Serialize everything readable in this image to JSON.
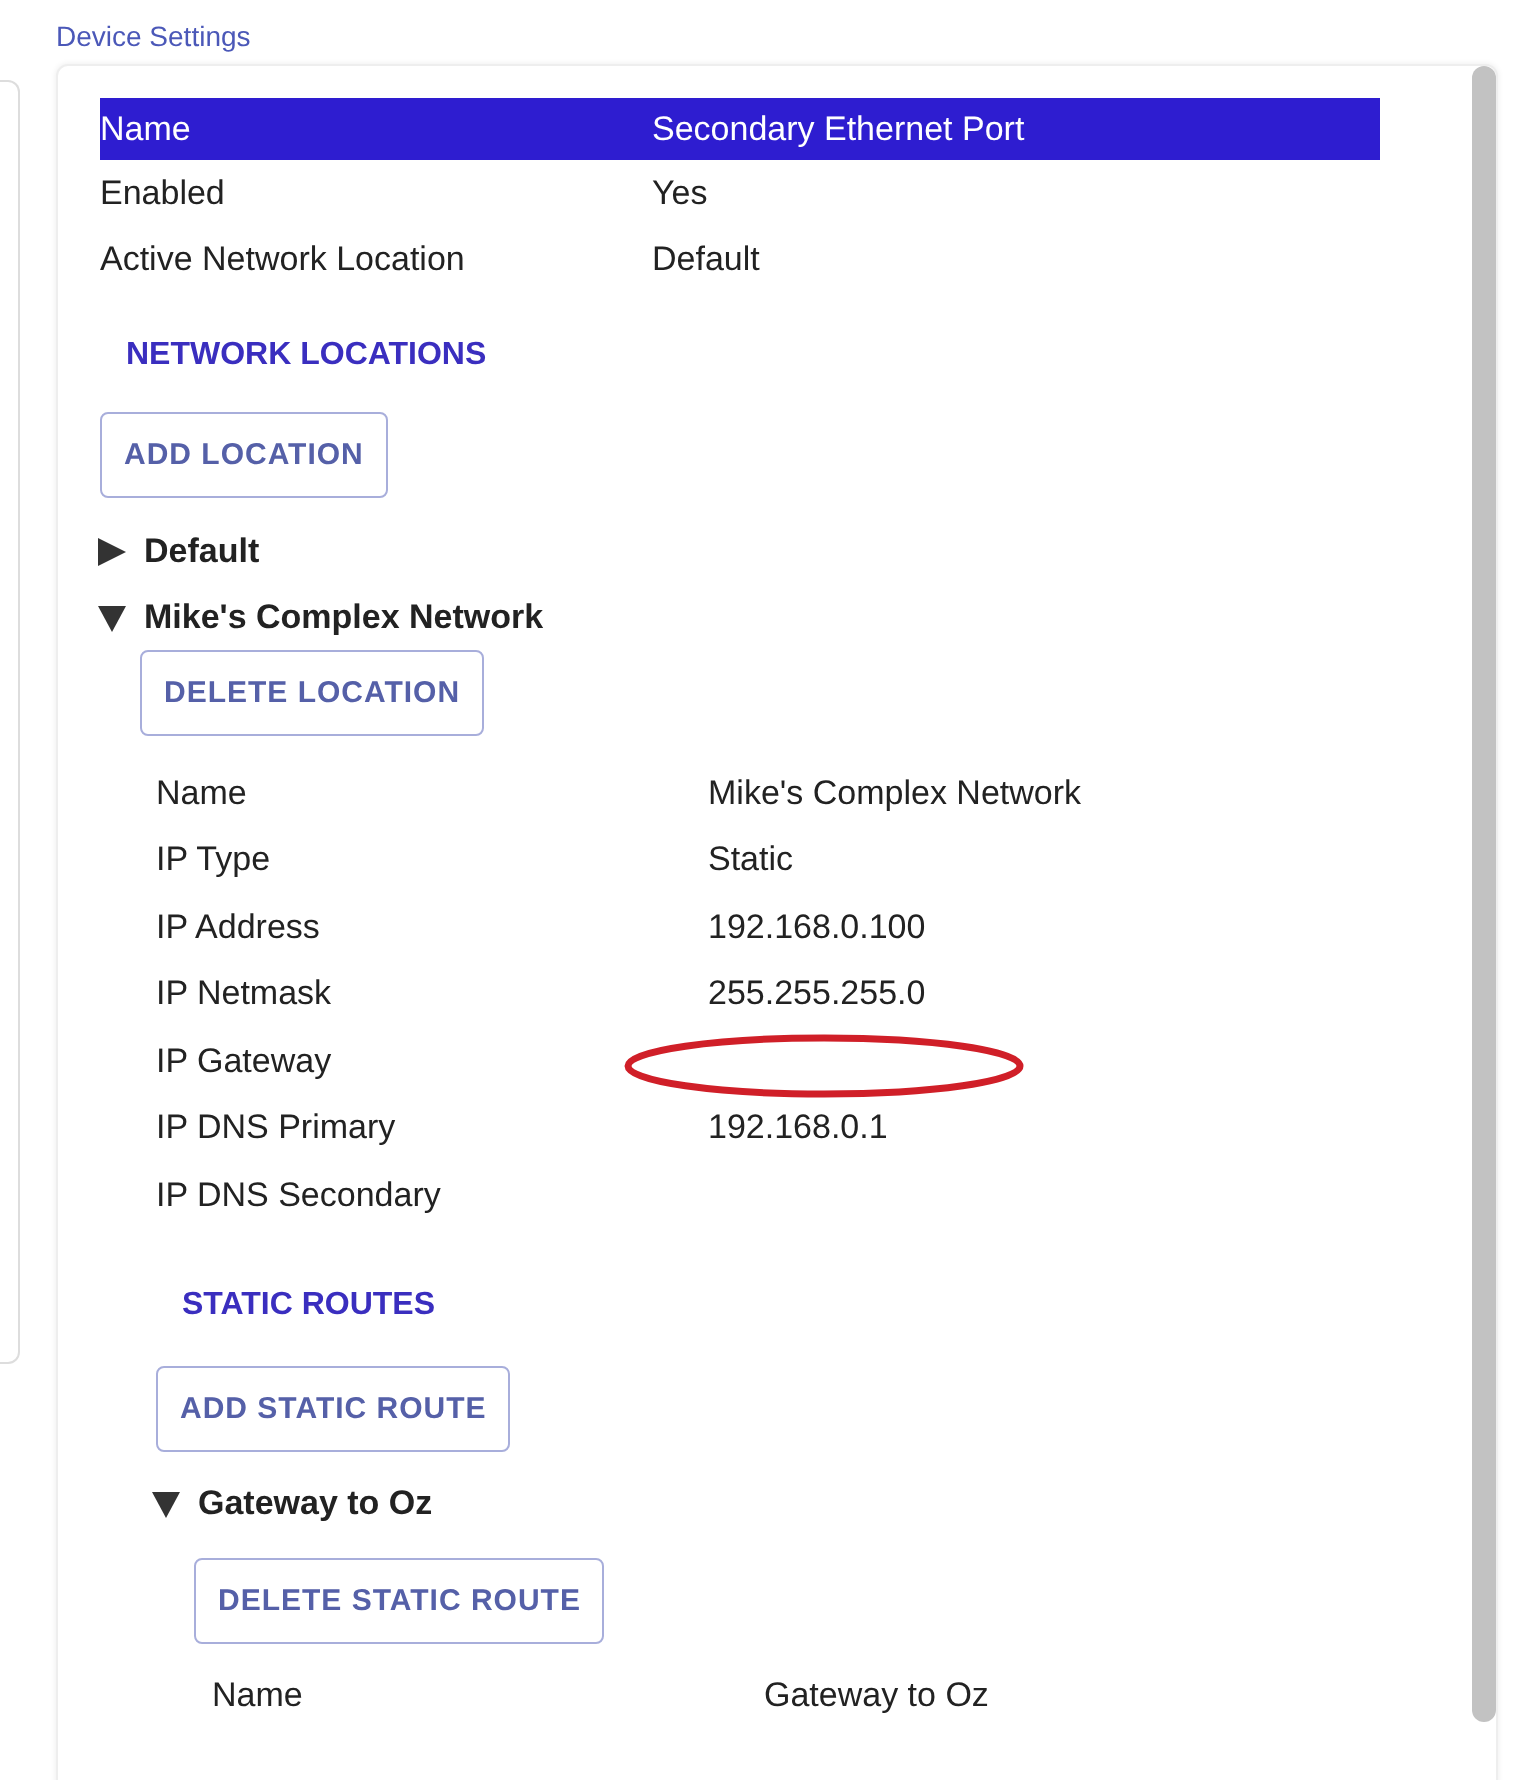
{
  "page_title": "Device Settings",
  "summary": {
    "header": {
      "label": "Name",
      "value": "Secondary Ethernet Port"
    },
    "rows": [
      {
        "label": "Enabled",
        "value": "Yes"
      },
      {
        "label": "Active Network Location",
        "value": "Default"
      }
    ]
  },
  "network_locations": {
    "heading": "NETWORK LOCATIONS",
    "add_button": "ADD LOCATION",
    "locations": [
      {
        "name": "Default",
        "expanded": false
      },
      {
        "name": "Mike's Complex Network",
        "expanded": true,
        "delete_button": "DELETE LOCATION",
        "properties": [
          {
            "label": "Name",
            "value": "Mike's Complex Network",
            "highlighted": false
          },
          {
            "label": "IP Type",
            "value": "Static",
            "highlighted": false
          },
          {
            "label": "IP Address",
            "value": "192.168.0.100",
            "highlighted": false
          },
          {
            "label": "IP Netmask",
            "value": "255.255.255.0",
            "highlighted": false
          },
          {
            "label": "IP Gateway",
            "highlighted": true
          },
          {
            "label": "IP DNS Primary",
            "value": "192.168.0.1",
            "highlighted": false
          },
          {
            "label": "IP DNS Secondary",
            "highlighted": false
          }
        ],
        "static_routes": {
          "heading": "STATIC ROUTES",
          "add_button": "ADD STATIC ROUTE",
          "routes": [
            {
              "name": "Gateway to Oz",
              "expanded": true,
              "delete_button": "DELETE STATIC ROUTE",
              "properties": [
                {
                  "label": "Name",
                  "value": "Gateway to Oz",
                  "highlighted": false
                }
              ]
            }
          ]
        }
      }
    ]
  }
}
